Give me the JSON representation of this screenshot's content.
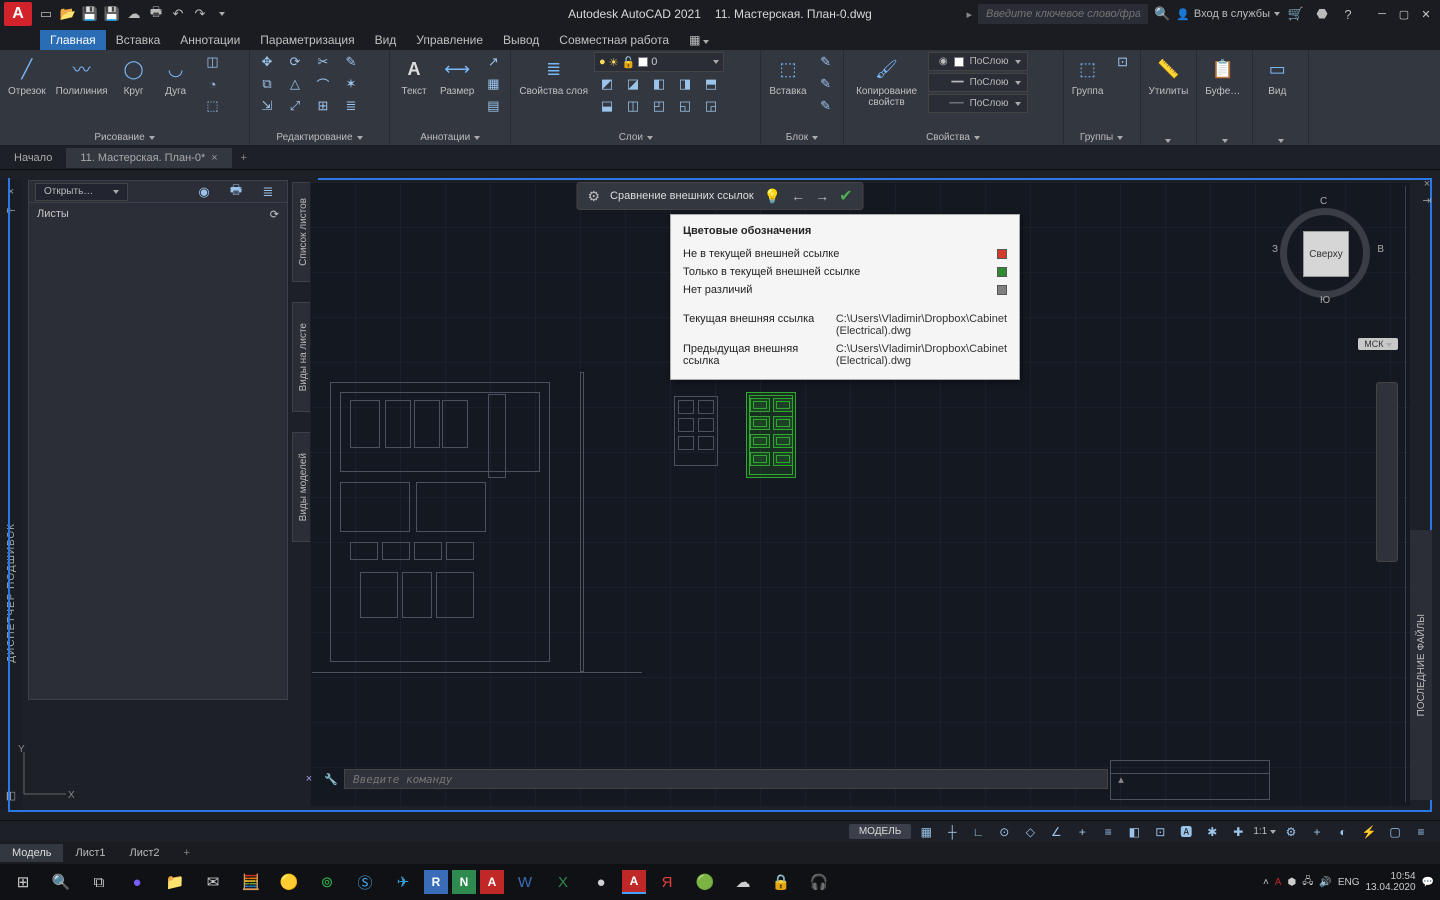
{
  "titlebar": {
    "app": "Autodesk AutoCAD 2021",
    "doc": "11. Мастерская. План-0.dwg",
    "search_placeholder": "Введите ключевое слово/фразу",
    "signin": "Вход в службы"
  },
  "menu": {
    "items": [
      "Главная",
      "Вставка",
      "Аннотации",
      "Параметризация",
      "Вид",
      "Управление",
      "Вывод",
      "Совместная работа"
    ],
    "active": 0
  },
  "ribbon": {
    "panels": [
      {
        "label": "Рисование",
        "big": [
          {
            "n": "Отрезок"
          },
          {
            "n": "Полилиния"
          },
          {
            "n": "Круг"
          },
          {
            "n": "Дуга"
          }
        ]
      },
      {
        "label": "Редактирование"
      },
      {
        "label": "Аннотации",
        "big": [
          {
            "n": "Текст"
          },
          {
            "n": "Размер"
          }
        ]
      },
      {
        "label": "Слои",
        "big": [
          {
            "n": "Свойства слоя"
          }
        ],
        "layer_current": "0"
      },
      {
        "label": "Блок",
        "big": [
          {
            "n": "Вставка"
          }
        ]
      },
      {
        "label": "Свойства",
        "copy_props": "Копирование свойств",
        "prop": "ПоСлою"
      },
      {
        "label": "Группы",
        "big": [
          {
            "n": "Группа"
          }
        ]
      },
      {
        "label": "",
        "big": [
          {
            "n": "Утилиты"
          }
        ]
      },
      {
        "label": "",
        "big": [
          {
            "n": "Буфе…"
          }
        ]
      },
      {
        "label": "",
        "big": [
          {
            "n": "Вид"
          }
        ]
      }
    ]
  },
  "doctabs": {
    "start": "Начало",
    "active": "11. Мастерская. План-0*"
  },
  "ssm": {
    "open": "Открыть…",
    "sheets": "Листы"
  },
  "vpanels": {
    "a": "Список листов",
    "b": "Виды на листе",
    "c": "Виды моделей",
    "dispatcher": "ДИСПЕТЧЕР ПОДШИВОК",
    "recent": "ПОСЛЕДНИЕ ФАЙЛЫ"
  },
  "compare_bar": {
    "title": "Сравнение внешних ссылок"
  },
  "legend": {
    "title": "Цветовые обозначения",
    "rows": [
      {
        "label": "Не в текущей внешней ссылке",
        "color": "#d43c2a"
      },
      {
        "label": "Только в текущей внешней ссылке",
        "color": "#2e8b2e"
      },
      {
        "label": "Нет различий",
        "color": "#808080"
      }
    ],
    "current_label": "Текущая внешняя ссылка",
    "current_path": "C:\\Users\\Vladimir\\Dropbox\\Cabinet (Electrical).dwg",
    "prev_label": "Предыдущая внешняя ссылка",
    "prev_path": "C:\\Users\\Vladimir\\Dropbox\\Cabinet (Electrical).dwg"
  },
  "viewcube": {
    "face": "Сверху",
    "n": "С",
    "s": "Ю",
    "e": "В",
    "w": "З",
    "wcs": "МСК"
  },
  "cmdline": {
    "placeholder": "Введите команду"
  },
  "layout_tabs": {
    "items": [
      "Модель",
      "Лист1",
      "Лист2"
    ],
    "active": 0
  },
  "statusbar": {
    "model": "МОДЕЛЬ",
    "scale": "1:1"
  },
  "taskbar": {
    "lang": "ENG",
    "time": "10:54",
    "date": "13.04.2020"
  }
}
